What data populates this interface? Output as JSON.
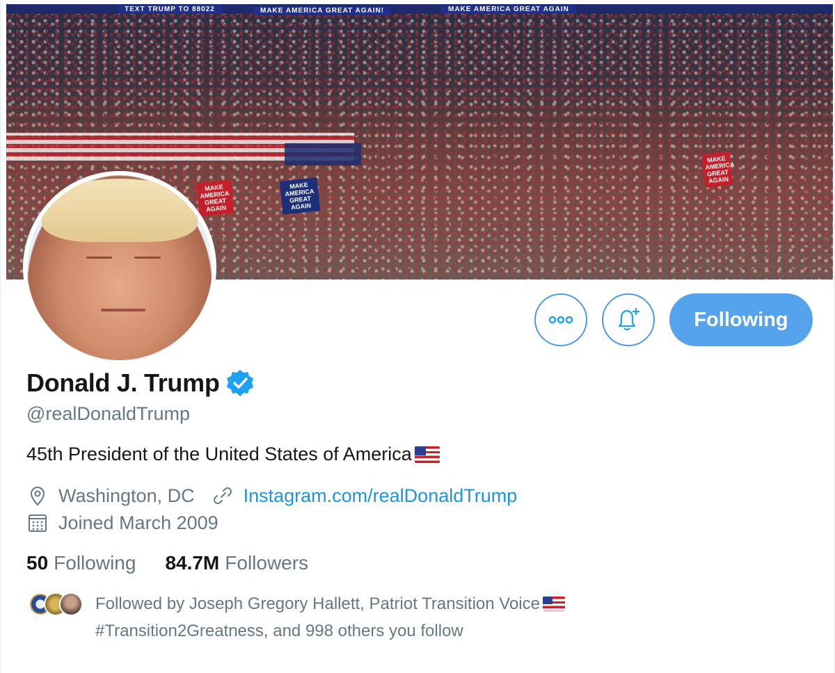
{
  "banner": {
    "text_left": "TEXT TRUMP TO 88022",
    "text_mid": "MAKE AMERICA GREAT AGAIN!",
    "text_right": "MAKE AMERICA GREAT AGAIN",
    "sign1": "MAKE AMERICA GREAT AGAIN",
    "sign2": "MAKE AMERICA GREAT AGAIN",
    "sign3": "MAKE AMERICA GREAT AGAIN"
  },
  "profile": {
    "name": "Donald J. Trump",
    "handle": "@realDonaldTrump",
    "bio": "45th President of the United States of America",
    "location": "Washington, DC",
    "website": "Instagram.com/realDonaldTrump",
    "joined": "Joined March 2009"
  },
  "stats": {
    "following_count": "50",
    "following_label": "Following",
    "followers_count": "84.7M",
    "followers_label": "Followers"
  },
  "actions": {
    "following_button": "Following",
    "more_icon": "more-horizontal-icon",
    "notify_icon": "bell-plus-icon"
  },
  "followed_by": {
    "line1": "Followed by Joseph Gregory Hallett, Patriot Transition Voice",
    "line2": "#Transition2Greatness, and 998 others you follow"
  },
  "colors": {
    "accent": "#1da1f2",
    "following_bg": "#55a2ed",
    "secondary_text": "#657786",
    "link": "#1b95e0"
  }
}
